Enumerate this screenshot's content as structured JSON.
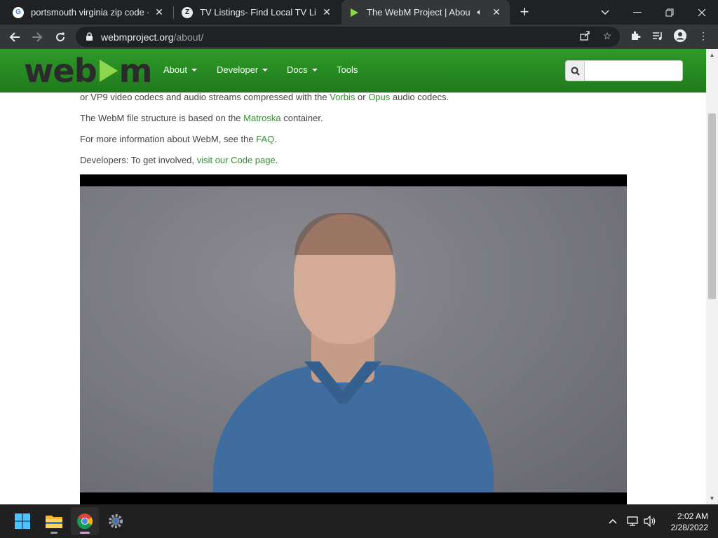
{
  "browser": {
    "tabs": [
      {
        "title": "portsmouth virginia zip code - G",
        "favicon": "google-icon",
        "active": false
      },
      {
        "title": "TV Listings- Find Local TV Listing",
        "favicon": "tv-listings-icon",
        "active": false
      },
      {
        "title": "The WebM Project | About W",
        "favicon": "webm-icon",
        "active": true,
        "audio": true
      }
    ],
    "url_host": "webmproject.org",
    "url_path": "/about/"
  },
  "site": {
    "logo_text_left": "web",
    "logo_text_right": "m",
    "nav": [
      {
        "label": "About",
        "dropdown": true
      },
      {
        "label": "Developer",
        "dropdown": true
      },
      {
        "label": "Docs",
        "dropdown": true
      },
      {
        "label": "Tools",
        "dropdown": false
      }
    ],
    "search_placeholder": ""
  },
  "content": {
    "line1_prefix": "or VP9 video codecs and audio streams compressed with the ",
    "line1_link1": "Vorbis",
    "line1_mid": " or ",
    "line1_link2": "Opus",
    "line1_suffix": " audio codecs.",
    "line2_prefix": "The WebM file structure is based on the ",
    "line2_link": "Matroska",
    "line2_suffix": " container.",
    "line3_prefix": "For more information about WebM, see the ",
    "line3_link": "FAQ",
    "line3_suffix": ".",
    "line4_prefix": "Developers: To get involved, ",
    "line4_link": "visit our Code page",
    "line4_suffix": "."
  },
  "taskbar": {
    "time": "2:02 AM",
    "date": "2/28/2022"
  },
  "colors": {
    "nav_green": "#2f9a2a",
    "link_green": "#3a8a3a",
    "logo_play": "#8cd64b"
  }
}
